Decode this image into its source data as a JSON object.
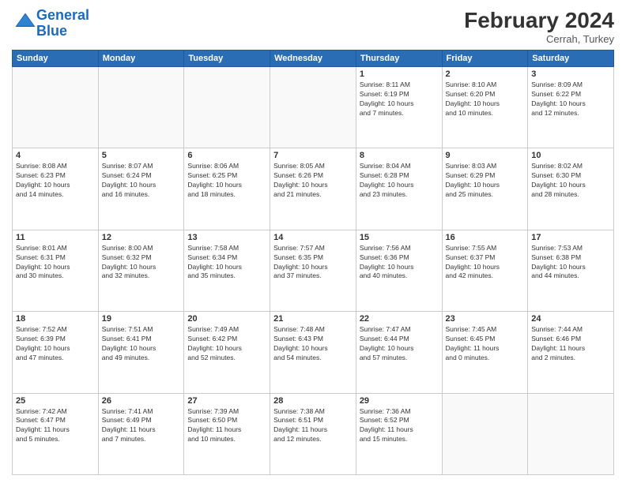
{
  "header": {
    "logo_line1": "General",
    "logo_line2": "Blue",
    "month": "February 2024",
    "location": "Cerrah, Turkey"
  },
  "weekdays": [
    "Sunday",
    "Monday",
    "Tuesday",
    "Wednesday",
    "Thursday",
    "Friday",
    "Saturday"
  ],
  "weeks": [
    [
      {
        "day": "",
        "info": ""
      },
      {
        "day": "",
        "info": ""
      },
      {
        "day": "",
        "info": ""
      },
      {
        "day": "",
        "info": ""
      },
      {
        "day": "1",
        "info": "Sunrise: 8:11 AM\nSunset: 6:19 PM\nDaylight: 10 hours\nand 7 minutes."
      },
      {
        "day": "2",
        "info": "Sunrise: 8:10 AM\nSunset: 6:20 PM\nDaylight: 10 hours\nand 10 minutes."
      },
      {
        "day": "3",
        "info": "Sunrise: 8:09 AM\nSunset: 6:22 PM\nDaylight: 10 hours\nand 12 minutes."
      }
    ],
    [
      {
        "day": "4",
        "info": "Sunrise: 8:08 AM\nSunset: 6:23 PM\nDaylight: 10 hours\nand 14 minutes."
      },
      {
        "day": "5",
        "info": "Sunrise: 8:07 AM\nSunset: 6:24 PM\nDaylight: 10 hours\nand 16 minutes."
      },
      {
        "day": "6",
        "info": "Sunrise: 8:06 AM\nSunset: 6:25 PM\nDaylight: 10 hours\nand 18 minutes."
      },
      {
        "day": "7",
        "info": "Sunrise: 8:05 AM\nSunset: 6:26 PM\nDaylight: 10 hours\nand 21 minutes."
      },
      {
        "day": "8",
        "info": "Sunrise: 8:04 AM\nSunset: 6:28 PM\nDaylight: 10 hours\nand 23 minutes."
      },
      {
        "day": "9",
        "info": "Sunrise: 8:03 AM\nSunset: 6:29 PM\nDaylight: 10 hours\nand 25 minutes."
      },
      {
        "day": "10",
        "info": "Sunrise: 8:02 AM\nSunset: 6:30 PM\nDaylight: 10 hours\nand 28 minutes."
      }
    ],
    [
      {
        "day": "11",
        "info": "Sunrise: 8:01 AM\nSunset: 6:31 PM\nDaylight: 10 hours\nand 30 minutes."
      },
      {
        "day": "12",
        "info": "Sunrise: 8:00 AM\nSunset: 6:32 PM\nDaylight: 10 hours\nand 32 minutes."
      },
      {
        "day": "13",
        "info": "Sunrise: 7:58 AM\nSunset: 6:34 PM\nDaylight: 10 hours\nand 35 minutes."
      },
      {
        "day": "14",
        "info": "Sunrise: 7:57 AM\nSunset: 6:35 PM\nDaylight: 10 hours\nand 37 minutes."
      },
      {
        "day": "15",
        "info": "Sunrise: 7:56 AM\nSunset: 6:36 PM\nDaylight: 10 hours\nand 40 minutes."
      },
      {
        "day": "16",
        "info": "Sunrise: 7:55 AM\nSunset: 6:37 PM\nDaylight: 10 hours\nand 42 minutes."
      },
      {
        "day": "17",
        "info": "Sunrise: 7:53 AM\nSunset: 6:38 PM\nDaylight: 10 hours\nand 44 minutes."
      }
    ],
    [
      {
        "day": "18",
        "info": "Sunrise: 7:52 AM\nSunset: 6:39 PM\nDaylight: 10 hours\nand 47 minutes."
      },
      {
        "day": "19",
        "info": "Sunrise: 7:51 AM\nSunset: 6:41 PM\nDaylight: 10 hours\nand 49 minutes."
      },
      {
        "day": "20",
        "info": "Sunrise: 7:49 AM\nSunset: 6:42 PM\nDaylight: 10 hours\nand 52 minutes."
      },
      {
        "day": "21",
        "info": "Sunrise: 7:48 AM\nSunset: 6:43 PM\nDaylight: 10 hours\nand 54 minutes."
      },
      {
        "day": "22",
        "info": "Sunrise: 7:47 AM\nSunset: 6:44 PM\nDaylight: 10 hours\nand 57 minutes."
      },
      {
        "day": "23",
        "info": "Sunrise: 7:45 AM\nSunset: 6:45 PM\nDaylight: 11 hours\nand 0 minutes."
      },
      {
        "day": "24",
        "info": "Sunrise: 7:44 AM\nSunset: 6:46 PM\nDaylight: 11 hours\nand 2 minutes."
      }
    ],
    [
      {
        "day": "25",
        "info": "Sunrise: 7:42 AM\nSunset: 6:47 PM\nDaylight: 11 hours\nand 5 minutes."
      },
      {
        "day": "26",
        "info": "Sunrise: 7:41 AM\nSunset: 6:49 PM\nDaylight: 11 hours\nand 7 minutes."
      },
      {
        "day": "27",
        "info": "Sunrise: 7:39 AM\nSunset: 6:50 PM\nDaylight: 11 hours\nand 10 minutes."
      },
      {
        "day": "28",
        "info": "Sunrise: 7:38 AM\nSunset: 6:51 PM\nDaylight: 11 hours\nand 12 minutes."
      },
      {
        "day": "29",
        "info": "Sunrise: 7:36 AM\nSunset: 6:52 PM\nDaylight: 11 hours\nand 15 minutes."
      },
      {
        "day": "",
        "info": ""
      },
      {
        "day": "",
        "info": ""
      }
    ]
  ]
}
